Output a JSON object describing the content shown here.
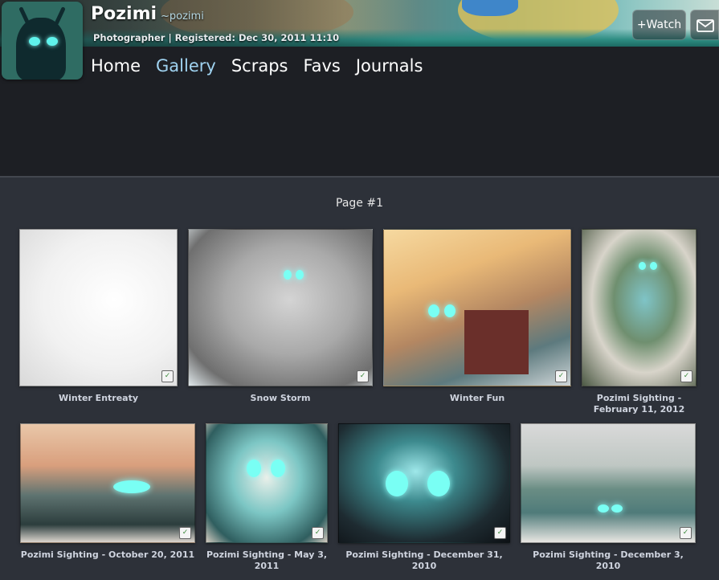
{
  "profile": {
    "name": "Pozimi",
    "handle": "~pozimi",
    "subline": "Photographer | Registered: Dec 30, 2011 11:10",
    "watch_label": "+Watch",
    "mail_icon": "envelope-icon"
  },
  "nav": {
    "items": [
      {
        "label": "Home"
      },
      {
        "label": "Gallery",
        "active": true
      },
      {
        "label": "Scraps"
      },
      {
        "label": "Favs"
      },
      {
        "label": "Journals"
      }
    ]
  },
  "gallery": {
    "page_label": "Page #1",
    "items": [
      {
        "title": "Winter Entreaty"
      },
      {
        "title": "Snow Storm"
      },
      {
        "title": "Winter Fun"
      },
      {
        "title": "Pozimi Sighting - February 11, 2012"
      },
      {
        "title": "Pozimi Sighting - October 20, 2011"
      },
      {
        "title": "Pozimi Sighting - May 3, 2011"
      },
      {
        "title": "Pozimi Sighting - December 31, 2010"
      },
      {
        "title": "Pozimi Sighting - December 3, 2010"
      }
    ],
    "badge_glyph": "✓"
  },
  "colors": {
    "page_bg": "#2d3139",
    "header_bg": "#1d1f24",
    "active_nav": "#9fd2f0",
    "caption": "#cfd4df"
  }
}
